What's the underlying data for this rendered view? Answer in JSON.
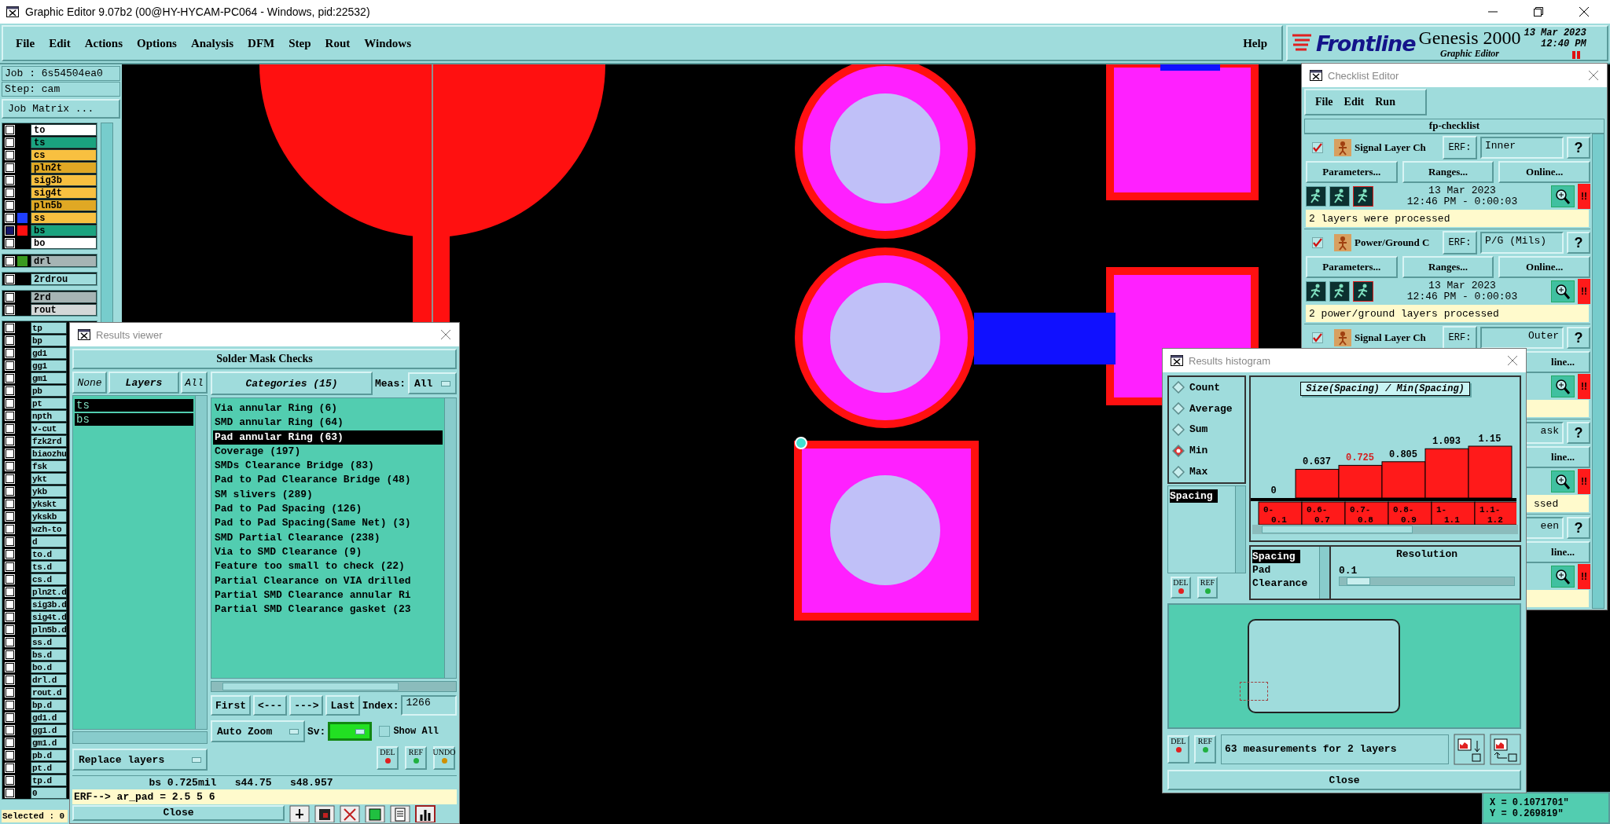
{
  "window": {
    "title": "Graphic Editor 9.07b2 (00@HY-HYCAM-PC064 - Windows, pid:22532)"
  },
  "menu": [
    "File",
    "Edit",
    "Actions",
    "Options",
    "Analysis",
    "DFM",
    "Step",
    "Rout",
    "Windows"
  ],
  "help": "Help",
  "brand": {
    "logo": "Frontline",
    "product": "Genesis 2000",
    "subtitle": "Graphic Editor",
    "date": "13 Mar 2023",
    "time": "12:40 PM"
  },
  "job_panel": {
    "job": "Job : 6s54504ea0",
    "step": "Step: cam",
    "matrix_button": "Job Matrix ...",
    "layer_groups": [
      [
        {
          "name": "to",
          "color": "#ffffff",
          "selected": false
        },
        {
          "name": "ts",
          "color": "#1aa37f",
          "selected": false
        },
        {
          "name": "cs",
          "color": "#f8c040",
          "selected": false
        },
        {
          "name": "pln2t",
          "color": "#e0a824",
          "selected": false
        },
        {
          "name": "sig3b",
          "color": "#f8c040",
          "selected": false
        },
        {
          "name": "sig4t",
          "color": "#f8c040",
          "selected": false
        },
        {
          "name": "pln5b",
          "color": "#e0a824",
          "selected": false
        },
        {
          "name": "ss",
          "color": "#f8c040",
          "marker": {
            "color": "#1f3fff"
          },
          "selected": false
        },
        {
          "name": "bs",
          "color": "#1aa37f",
          "marker": {
            "color": "#ff1010"
          },
          "selected": true
        },
        {
          "name": "bo",
          "color": "#ffffff",
          "selected": false
        }
      ],
      [
        {
          "name": "drl",
          "color": "#a6b4b4",
          "marker": {
            "color": "#3a9a20"
          },
          "selected": false
        }
      ],
      [
        {
          "name": "2rdrou",
          "color": "#9fdcdc",
          "selected": false
        }
      ],
      [
        {
          "name": "2rd",
          "color": "#a6b4b4",
          "selected": false
        },
        {
          "name": "rout",
          "color": "#d4d8d8",
          "selected": false
        }
      ],
      [
        {
          "name": "tp",
          "color": "#9fdcdc",
          "selected": false
        },
        {
          "name": "bp",
          "color": "#9fdcdc",
          "selected": false
        },
        {
          "name": "gd1",
          "color": "#9fdcdc",
          "selected": false
        },
        {
          "name": "gg1",
          "color": "#9fdcdc",
          "selected": false
        },
        {
          "name": "gm1",
          "color": "#9fdcdc",
          "selected": false
        },
        {
          "name": "pb",
          "color": "#9fdcdc",
          "selected": false
        },
        {
          "name": "pt",
          "color": "#9fdcdc",
          "selected": false
        },
        {
          "name": "npth",
          "color": "#9fdcdc",
          "selected": false
        },
        {
          "name": "v-cut",
          "color": "#9fdcdc",
          "selected": false
        },
        {
          "name": "fzk2rd",
          "color": "#9fdcdc",
          "selected": false
        },
        {
          "name": "biaozhu",
          "color": "#9fdcdc",
          "selected": false
        },
        {
          "name": "fsk",
          "color": "#9fdcdc",
          "selected": false
        },
        {
          "name": "ykt",
          "color": "#9fdcdc",
          "selected": false
        },
        {
          "name": "ykb",
          "color": "#9fdcdc",
          "selected": false
        },
        {
          "name": "ykskt",
          "color": "#9fdcdc",
          "selected": false
        },
        {
          "name": "ykskb",
          "color": "#9fdcdc",
          "selected": false
        },
        {
          "name": "wzh-to",
          "color": "#9fdcdc",
          "selected": false
        },
        {
          "name": "d",
          "color": "#9fdcdc",
          "selected": false
        },
        {
          "name": "to.d",
          "color": "#9fdcdc",
          "selected": false
        },
        {
          "name": "ts.d",
          "color": "#9fdcdc",
          "selected": false
        },
        {
          "name": "cs.d",
          "color": "#9fdcdc",
          "selected": false
        },
        {
          "name": "pln2t.d",
          "color": "#9fdcdc",
          "selected": false
        },
        {
          "name": "sig3b.d",
          "color": "#9fdcdc",
          "selected": false
        },
        {
          "name": "sig4t.d",
          "color": "#9fdcdc",
          "selected": false
        },
        {
          "name": "pln5b.d",
          "color": "#9fdcdc",
          "selected": false
        },
        {
          "name": "ss.d",
          "color": "#9fdcdc",
          "selected": false
        },
        {
          "name": "bs.d",
          "color": "#9fdcdc",
          "selected": false
        },
        {
          "name": "bo.d",
          "color": "#9fdcdc",
          "selected": false
        },
        {
          "name": "drl.d",
          "color": "#9fdcdc",
          "selected": false
        },
        {
          "name": "rout.d",
          "color": "#9fdcdc",
          "selected": false
        },
        {
          "name": "bp.d",
          "color": "#9fdcdc",
          "selected": false
        },
        {
          "name": "gd1.d",
          "color": "#9fdcdc",
          "selected": false
        },
        {
          "name": "gg1.d",
          "color": "#9fdcdc",
          "selected": false
        },
        {
          "name": "gm1.d",
          "color": "#9fdcdc",
          "selected": false
        },
        {
          "name": "pb.d",
          "color": "#9fdcdc",
          "selected": false
        },
        {
          "name": "pt.d",
          "color": "#9fdcdc",
          "selected": false
        },
        {
          "name": "tp.d",
          "color": "#9fdcdc",
          "selected": false
        },
        {
          "name": "0",
          "color": "#9fdcdc",
          "selected": false
        }
      ]
    ],
    "selected_count": "Selected : 0"
  },
  "results_viewer": {
    "title": "Results viewer",
    "header": "Solder Mask Checks",
    "layer_buttons": [
      "None",
      "Layers",
      "All"
    ],
    "layers": [
      {
        "name": "ts",
        "selected": true
      },
      {
        "name": "bs",
        "selected": true
      }
    ],
    "replace": "Replace layers",
    "categories_button": "Categories (15)",
    "meas_label": "Meas:",
    "meas_value": "All",
    "categories": [
      {
        "label": "Via annular Ring (6)",
        "selected": false
      },
      {
        "label": "SMD annular Ring (64)",
        "selected": false
      },
      {
        "label": "Pad annular Ring (63)",
        "selected": true
      },
      {
        "label": "Coverage (197)",
        "selected": false
      },
      {
        "label": "SMDs Clearance Bridge (83)",
        "selected": false
      },
      {
        "label": "Pad to Pad Clearance Bridge (48)",
        "selected": false
      },
      {
        "label": "SM slivers (289)",
        "selected": false
      },
      {
        "label": "Pad to Pad Spacing (126)",
        "selected": false
      },
      {
        "label": "Pad to Pad Spacing(Same Net) (3)",
        "selected": false
      },
      {
        "label": "SMD Partial Clearance (238)",
        "selected": false
      },
      {
        "label": "Via to SMD Clearance (9)",
        "selected": false
      },
      {
        "label": "Feature too small to check (22)",
        "selected": false
      },
      {
        "label": "Partial Clearance on VIA drilled",
        "selected": false
      },
      {
        "label": "Partial SMD Clearance annular Ri",
        "selected": false
      },
      {
        "label": "Partial SMD Clearance gasket (23",
        "selected": false
      }
    ],
    "nav": [
      "First",
      "<---",
      "--->",
      "Last"
    ],
    "index_label": "Index:",
    "index_value": "1266",
    "zoom_mode": "Auto Zoom",
    "sv_label": "Sv:",
    "show_all": {
      "label": "Show All",
      "checked": false
    },
    "icon_buttons": [
      {
        "label": "DEL",
        "color": "#e02020"
      },
      {
        "label": "REF",
        "color": "#20b040"
      },
      {
        "label": "UNDO",
        "color": "#d09000"
      }
    ],
    "status": "bs 0.725mil   s44.75   s48.957",
    "erf": "ERF--> ar_pad = 2.5 5 6",
    "close": "Close"
  },
  "checklist": {
    "title": "Checklist Editor",
    "menu": [
      "File",
      "Edit",
      "Run"
    ],
    "name": "fp-checklist",
    "items": [
      {
        "kind": "full",
        "checked": true,
        "name": "Signal Layer Ch",
        "erf_label": "ERF:",
        "erf": "Inner",
        "help": "?",
        "buttons": [
          "Parameters...",
          "Ranges...",
          "Online..."
        ],
        "date": "13 Mar 2023",
        "time": "12:46 PM - 0:00:03",
        "alert": "!!",
        "message": "2 layers were processed"
      },
      {
        "kind": "full",
        "checked": true,
        "name": "Power/Ground C",
        "erf_label": "ERF:",
        "erf": "P/G (Mils)",
        "help": "?",
        "buttons": [
          "Parameters...",
          "Ranges...",
          "Online..."
        ],
        "date": "13 Mar 2023",
        "time": "12:46 PM - 0:00:03",
        "alert": "!!",
        "message": "2 power/ground layers processed"
      },
      {
        "kind": "covered",
        "checked": true,
        "name": "Signal Layer Ch",
        "erf_label": "ERF:",
        "erf": "Outer",
        "help": "?",
        "online": "line...",
        "alert": "!!"
      },
      {
        "kind": "covered",
        "erf": "ask",
        "help": "?",
        "online": "line...",
        "alert": "!!",
        "message": "ssed"
      },
      {
        "kind": "covered",
        "erf": "een",
        "help": "?",
        "online": "line...",
        "alert": "!!"
      }
    ]
  },
  "histogram": {
    "title": "Results histogram",
    "modes": [
      {
        "label": "Count",
        "selected": false
      },
      {
        "label": "Average",
        "selected": false
      },
      {
        "label": "Sum",
        "selected": false
      },
      {
        "label": "Min",
        "selected": true
      },
      {
        "label": "Max",
        "selected": false
      }
    ],
    "fields": [
      {
        "label": "Spacing",
        "selected": true
      }
    ],
    "chart_data": {
      "type": "bar",
      "title": "Size(Spacing) / Min(Spacing)",
      "categories": [
        "0-0.1",
        "0.6-0.7",
        "0.7-0.8",
        "0.8-0.9",
        "1-1.1",
        "1.1-1.2"
      ],
      "values": [
        0,
        0.637,
        0.725,
        0.805,
        1.093,
        1.15
      ],
      "data_labels": true
    },
    "bins": [
      {
        "selected": false
      },
      {
        "selected": false
      },
      {
        "selected": true
      },
      {
        "selected": false
      },
      {
        "selected": false
      },
      {
        "selected": false
      }
    ],
    "field_buttons": [
      {
        "label": "DEL",
        "color": "#e02020"
      },
      {
        "label": "REF",
        "color": "#20b040"
      }
    ],
    "attributes": [
      {
        "label": "Spacing",
        "selected": true
      },
      {
        "label": "Pad",
        "selected": false
      },
      {
        "label": "Clearance",
        "selected": false
      }
    ],
    "resolution_label": "Resolution",
    "resolution_value": "0.1",
    "resolution_slider": {
      "level": 0.04
    },
    "footer_buttons": [
      {
        "label": "DEL",
        "color": "#e02020"
      },
      {
        "label": "REF",
        "color": "#20b040"
      }
    ],
    "summary": "63 measurements for 2 layers",
    "close": "Close"
  },
  "coordinates": [
    "X = 0.1071701\"",
    "Y = 0.269819\""
  ]
}
